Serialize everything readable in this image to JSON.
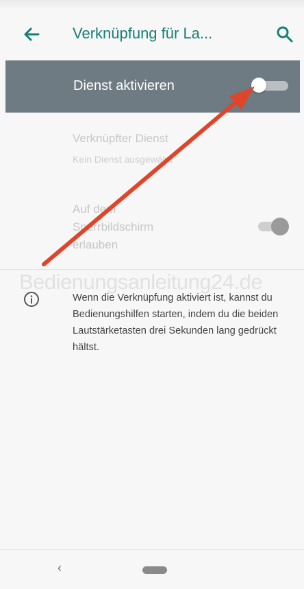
{
  "app_bar": {
    "title": "Verknüpfung für La...",
    "back_icon": "arrow-left-icon",
    "search_icon": "search-icon"
  },
  "master_switch": {
    "label": "Dienst aktivieren",
    "state": "off"
  },
  "linked_service": {
    "title": "Verknüpfter Dienst",
    "subtitle": "Kein Dienst ausgewählt"
  },
  "lockscreen_option": {
    "label": "Auf dem Sperrbildschirm erlauben",
    "state": "on"
  },
  "watermark": "Bedienungsanleitung24.de",
  "info": {
    "icon": "info-icon",
    "text": "Wenn die Verknüpfung aktiviert ist, kannst du Bedienungshilfen starten, indem du die beiden Lautstärketasten drei Sekunden lang gedrückt hältst."
  },
  "nav": {
    "back": "‹",
    "home": "home-pill"
  },
  "colors": {
    "accent": "#167f75",
    "master_bg": "#6f7b82",
    "arrow": "#e0442a"
  }
}
